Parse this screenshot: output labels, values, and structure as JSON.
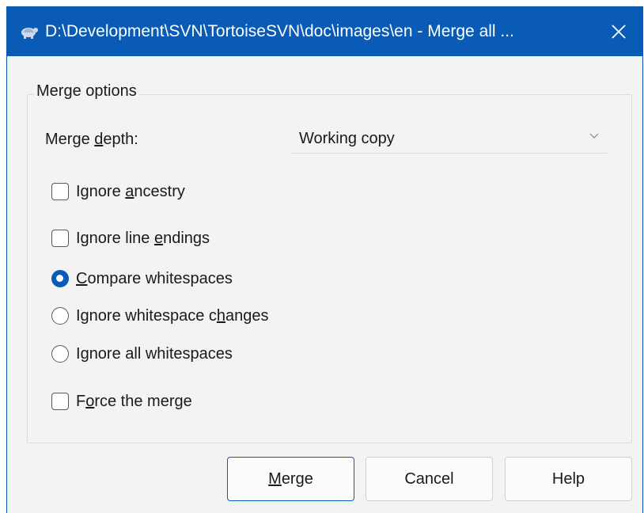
{
  "window": {
    "title": "D:\\Development\\SVN\\TortoiseSVN\\doc\\images\\en - Merge all ...",
    "app_icon": "tortoise-icon",
    "close_icon": "close-icon"
  },
  "options": {
    "group_title": "Merge options",
    "depth_label_pre": "Merge ",
    "depth_label_ul": "d",
    "depth_label_post": "epth:",
    "depth_value": "Working copy",
    "ignore_ancestry": {
      "pre": "Ignore ",
      "ul": "a",
      "post": "ncestry",
      "checked": false
    },
    "ignore_line_endings": {
      "pre": "Ignore line ",
      "ul": "e",
      "post": "ndings",
      "checked": false
    },
    "whitespace": [
      {
        "pre": "",
        "ul": "C",
        "post": "ompare whitespaces",
        "checked": true
      },
      {
        "pre": "Ignore whitespace c",
        "ul": "h",
        "post": "anges",
        "checked": false
      },
      {
        "pre": "I",
        "ul": "g",
        "post": "nore all whitespaces",
        "checked": false
      }
    ],
    "force_merge": {
      "pre": "F",
      "ul": "o",
      "post": "rce the merge",
      "checked": false
    }
  },
  "buttons": {
    "merge": {
      "pre": "",
      "ul": "M",
      "post": "erge"
    },
    "cancel": "Cancel",
    "help": "Help"
  },
  "colors": {
    "accent": "#0a5bb5",
    "background": "#f3f3f3"
  }
}
